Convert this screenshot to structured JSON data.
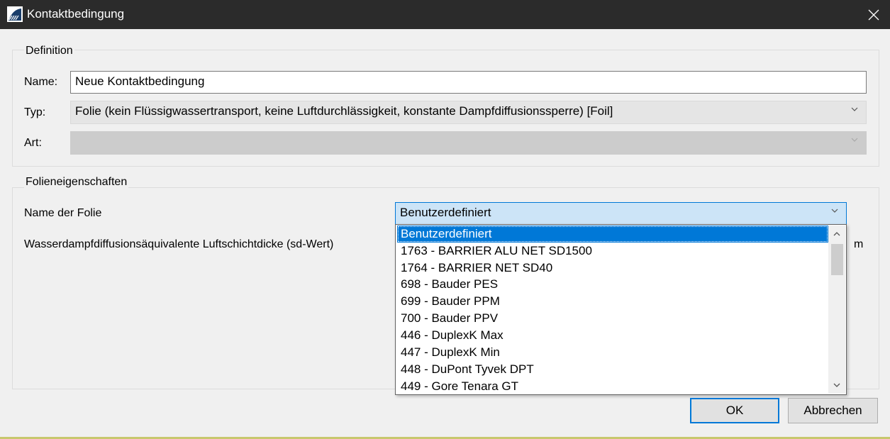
{
  "window": {
    "title": "Kontaktbedingung"
  },
  "definition": {
    "group_title": "Definition",
    "name_label": "Name:",
    "name_value": "Neue Kontaktbedingung",
    "typ_label": "Typ:",
    "typ_value": "Folie (kein Flüssigwassertransport, keine Luftdurchlässigkeit, konstante Dampfdiffusionssperre) [Foil]",
    "art_label": "Art:",
    "art_value": ""
  },
  "folie": {
    "group_title": "Folieneigenschaften",
    "name_label": "Name der Folie",
    "name_value": "Benutzerdefiniert",
    "sd_label": "Wasserdampfdiffusionsäquivalente Luftschichtdicke (sd-Wert)",
    "sd_unit": "m",
    "dropdown_items": [
      "Benutzerdefiniert",
      "1763 - BARRIER ALU NET SD1500",
      "1764 - BARRIER NET SD40",
      "698 - Bauder PES",
      "699 - Bauder PPM",
      "700 - Bauder PPV",
      "446 - DuplexK Max",
      "447 - DuplexK Min",
      "448 - DuPont Tyvek DPT",
      "449 - Gore Tenara GT"
    ],
    "selected_index": 0
  },
  "buttons": {
    "ok": "OK",
    "cancel": "Abbrechen"
  },
  "colors": {
    "titlebar": "#2b2b2b",
    "accent": "#0078d7",
    "selection_bg": "#0078d7",
    "combo_active_bg": "#cce4f7"
  },
  "icons": [
    "app-icon",
    "close-icon",
    "chevron-down-icon",
    "scroll-up-icon",
    "scroll-down-icon"
  ]
}
